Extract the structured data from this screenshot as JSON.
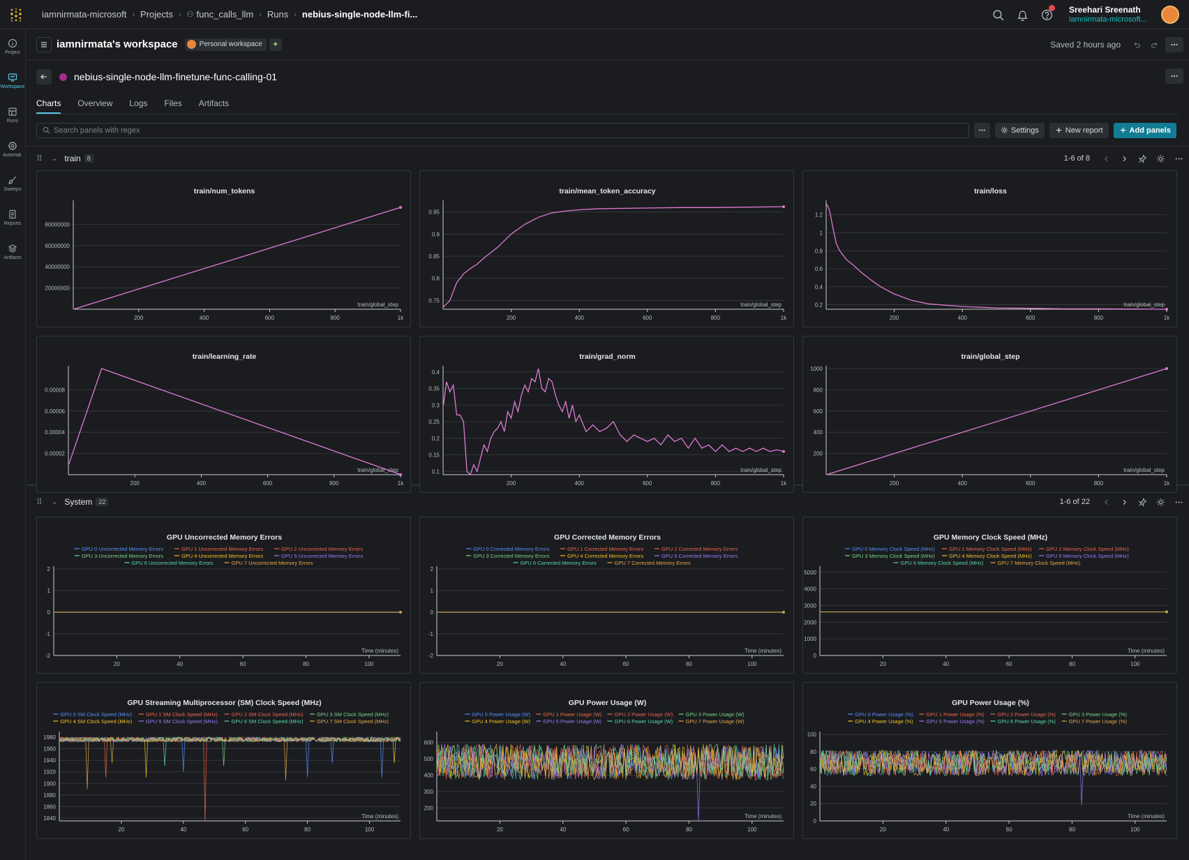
{
  "topbar": {
    "breadcrumbs": [
      "iamnirmata-microsoft",
      "Projects",
      "func_calls_llm",
      "Runs",
      "nebius-single-node-llm-fi..."
    ],
    "user_name": "Sreehari Sreenath",
    "user_handle": "iamnirmata-microsoft..."
  },
  "leftnav": {
    "items": [
      {
        "label": "Project",
        "icon": "info-icon"
      },
      {
        "label": "Workspace",
        "icon": "workspace-icon"
      },
      {
        "label": "Runs",
        "icon": "table-icon"
      },
      {
        "label": "Automat.",
        "icon": "automation-icon"
      },
      {
        "label": "Sweeps",
        "icon": "broom-icon"
      },
      {
        "label": "Reports",
        "icon": "report-icon"
      },
      {
        "label": "Artifacts",
        "icon": "layers-icon"
      }
    ]
  },
  "workspace": {
    "title": "iamnirmata's workspace",
    "badge": "Personal workspace",
    "saved": "Saved 2 hours ago"
  },
  "run": {
    "name": "nebius-single-node-llm-finetune-func-calling-01",
    "color": "#a62d8c"
  },
  "tabs": [
    "Charts",
    "Overview",
    "Logs",
    "Files",
    "Artifacts"
  ],
  "toolbar": {
    "search_placeholder": "Search panels with regex",
    "settings": "Settings",
    "new_report": "New report",
    "add_panels": "Add panels"
  },
  "sections": {
    "train": {
      "title": "train",
      "count": "8",
      "pagination": "1-6 of 8"
    },
    "system": {
      "title": "System",
      "count": "22",
      "pagination": "1-6 of 22"
    }
  },
  "gpu_colors": [
    "#5b8ff9",
    "#f4664a",
    "#e86452",
    "#7ed38a",
    "#f6c022",
    "#9d7af5",
    "#5ad8a6",
    "#e8a84a"
  ],
  "chart_data": [
    {
      "type": "line",
      "title": "train/num_tokens",
      "xlabel": "train/global_step",
      "x": [
        1,
        1000
      ],
      "y": [
        0,
        96000000
      ],
      "xlim": [
        0,
        1000
      ],
      "ylim": [
        0,
        100000000
      ],
      "xticks": [
        200,
        400,
        600,
        800,
        1000
      ],
      "xtick_labels": [
        "200",
        "400",
        "600",
        "800",
        "1k"
      ],
      "yticks": [
        20000000,
        40000000,
        60000000,
        80000000
      ],
      "ytick_labels": [
        "20000000",
        "40000000",
        "60000000",
        "80000000"
      ]
    },
    {
      "type": "line",
      "title": "train/mean_token_accuracy",
      "xlabel": "train/global_step",
      "x": [
        1,
        20,
        30,
        40,
        60,
        80,
        100,
        120,
        140,
        160,
        180,
        200,
        240,
        280,
        320,
        360,
        400,
        450,
        500,
        600,
        700,
        800,
        900,
        1000
      ],
      "y": [
        0.735,
        0.75,
        0.77,
        0.79,
        0.81,
        0.822,
        0.832,
        0.846,
        0.858,
        0.87,
        0.885,
        0.9,
        0.922,
        0.938,
        0.948,
        0.952,
        0.955,
        0.957,
        0.958,
        0.959,
        0.96,
        0.96,
        0.961,
        0.962
      ],
      "xlim": [
        0,
        1000
      ],
      "ylim": [
        0.73,
        0.97
      ],
      "xticks": [
        200,
        400,
        600,
        800,
        1000
      ],
      "xtick_labels": [
        "200",
        "400",
        "600",
        "800",
        "1k"
      ],
      "yticks": [
        0.75,
        0.8,
        0.85,
        0.9,
        0.95
      ],
      "ytick_labels": [
        "0.75",
        "0.8",
        "0.85",
        "0.9",
        "0.95"
      ]
    },
    {
      "type": "line",
      "title": "train/loss",
      "xlabel": "train/global_step",
      "x": [
        1,
        10,
        20,
        30,
        40,
        60,
        80,
        100,
        130,
        160,
        200,
        250,
        300,
        400,
        500,
        600,
        700,
        800,
        900,
        1000
      ],
      "y": [
        1.32,
        1.25,
        1.05,
        0.88,
        0.8,
        0.7,
        0.64,
        0.57,
        0.48,
        0.4,
        0.32,
        0.25,
        0.21,
        0.18,
        0.165,
        0.16,
        0.155,
        0.155,
        0.152,
        0.15
      ],
      "xlim": [
        0,
        1000
      ],
      "ylim": [
        0.15,
        1.33
      ],
      "xticks": [
        200,
        400,
        600,
        800,
        1000
      ],
      "xtick_labels": [
        "200",
        "400",
        "600",
        "800",
        "1k"
      ],
      "yticks": [
        0.2,
        0.4,
        0.6,
        0.8,
        1,
        1.2
      ],
      "ytick_labels": [
        "0.2",
        "0.4",
        "0.6",
        "0.8",
        "1",
        "1.2"
      ]
    },
    {
      "type": "line",
      "title": "train/learning_rate",
      "xlabel": "train/global_step",
      "x": [
        1,
        100,
        1000
      ],
      "y": [
        9.5e-06,
        0.0001,
        1e-07
      ],
      "xlim": [
        0,
        1000
      ],
      "ylim": [
        0,
        0.0001
      ],
      "xticks": [
        200,
        400,
        600,
        800,
        1000
      ],
      "xtick_labels": [
        "200",
        "400",
        "600",
        "800",
        "1k"
      ],
      "yticks": [
        2e-05,
        4e-05,
        6e-05,
        8e-05
      ],
      "ytick_labels": [
        "0.00002",
        "0.00004",
        "0.00006",
        "0.00008"
      ]
    },
    {
      "type": "line",
      "title": "train/grad_norm",
      "xlabel": "train/global_step",
      "x": [
        1,
        10,
        20,
        30,
        40,
        50,
        60,
        70,
        80,
        90,
        100,
        110,
        120,
        130,
        140,
        150,
        160,
        170,
        180,
        190,
        200,
        210,
        220,
        230,
        240,
        250,
        260,
        270,
        280,
        290,
        300,
        310,
        320,
        330,
        340,
        350,
        360,
        370,
        380,
        390,
        400,
        420,
        440,
        460,
        480,
        500,
        520,
        540,
        560,
        580,
        600,
        620,
        640,
        660,
        680,
        700,
        720,
        740,
        760,
        780,
        800,
        820,
        840,
        860,
        880,
        900,
        920,
        940,
        960,
        980,
        1000
      ],
      "y": [
        0.3,
        0.37,
        0.34,
        0.36,
        0.27,
        0.27,
        0.25,
        0.1,
        0.09,
        0.12,
        0.1,
        0.14,
        0.18,
        0.16,
        0.2,
        0.22,
        0.23,
        0.25,
        0.22,
        0.28,
        0.26,
        0.31,
        0.28,
        0.33,
        0.36,
        0.34,
        0.38,
        0.37,
        0.41,
        0.35,
        0.34,
        0.38,
        0.37,
        0.33,
        0.3,
        0.28,
        0.31,
        0.26,
        0.3,
        0.25,
        0.27,
        0.22,
        0.24,
        0.22,
        0.23,
        0.25,
        0.21,
        0.19,
        0.21,
        0.2,
        0.19,
        0.2,
        0.18,
        0.21,
        0.19,
        0.2,
        0.17,
        0.2,
        0.17,
        0.18,
        0.16,
        0.18,
        0.16,
        0.17,
        0.16,
        0.17,
        0.16,
        0.17,
        0.16,
        0.165,
        0.16
      ],
      "xlim": [
        0,
        1000
      ],
      "ylim": [
        0.09,
        0.41
      ],
      "xticks": [
        200,
        400,
        600,
        800,
        1000
      ],
      "xtick_labels": [
        "200",
        "400",
        "600",
        "800",
        "1k"
      ],
      "yticks": [
        0.1,
        0.15,
        0.2,
        0.25,
        0.3,
        0.35,
        0.4
      ],
      "ytick_labels": [
        "0.1",
        "0.15",
        "0.2",
        "0.25",
        "0.3",
        "0.35",
        "0.4"
      ]
    },
    {
      "type": "line",
      "title": "train/global_step",
      "xlabel": "train/global_step",
      "x": [
        1,
        1000
      ],
      "y": [
        0,
        1000
      ],
      "xlim": [
        0,
        1000
      ],
      "ylim": [
        0,
        1000
      ],
      "xticks": [
        200,
        400,
        600,
        800,
        1000
      ],
      "xtick_labels": [
        "200",
        "400",
        "600",
        "800",
        "1k"
      ],
      "yticks": [
        200,
        400,
        600,
        800,
        1000
      ],
      "ytick_labels": [
        "200",
        "400",
        "600",
        "800",
        "1000"
      ]
    },
    {
      "type": "line",
      "title": "GPU Uncorrected Memory Errors",
      "xlabel": "Time (minutes)",
      "legend": [
        "GPU 0 Uncorrected Memory Errors",
        "GPU 1 Uncorrected Memory Errors",
        "GPU 2 Uncorrected Memory Errors",
        "GPU 3 Uncorrected Memory Errors",
        "GPU 4 Uncorrected Memory Errors",
        "GPU 5 Uncorrected Memory Errors",
        "GPU 6 Uncorrected Memory Errors",
        "GPU 7 Uncorrected Memory Errors"
      ],
      "legend_rows": [
        3,
        3,
        2
      ],
      "constant": 0,
      "xlim": [
        0,
        110
      ],
      "ylim": [
        -2,
        2
      ],
      "xticks": [
        20,
        40,
        60,
        80,
        100
      ],
      "xtick_labels": [
        "20",
        "40",
        "60",
        "80",
        "100"
      ],
      "yticks": [
        -2,
        -1,
        0,
        1,
        2
      ],
      "ytick_labels": [
        "-2",
        "-1",
        "0",
        "1",
        "2"
      ]
    },
    {
      "type": "line",
      "title": "GPU Corrected Memory Errors",
      "xlabel": "Time (minutes)",
      "legend": [
        "GPU 0 Corrected Memory Errors",
        "GPU 1 Corrected Memory Errors",
        "GPU 2 Corrected Memory Errors",
        "GPU 3 Corrected Memory Errors",
        "GPU 4 Corrected Memory Errors",
        "GPU 5 Corrected Memory Errors",
        "GPU 6 Corrected Memory Errors",
        "GPU 7 Corrected Memory Errors"
      ],
      "legend_rows": [
        3,
        3,
        2
      ],
      "constant": 0,
      "xlim": [
        0,
        110
      ],
      "ylim": [
        -2,
        2
      ],
      "xticks": [
        20,
        40,
        60,
        80,
        100
      ],
      "xtick_labels": [
        "20",
        "40",
        "60",
        "80",
        "100"
      ],
      "yticks": [
        -2,
        -1,
        0,
        1,
        2
      ],
      "ytick_labels": [
        "-2",
        "-1",
        "0",
        "1",
        "2"
      ]
    },
    {
      "type": "line",
      "title": "GPU Memory Clock Speed (MHz)",
      "xlabel": "Time (minutes)",
      "legend": [
        "GPU 0 Memory Clock Speed (MHz)",
        "GPU 1 Memory Clock Speed (MHz)",
        "GPU 2 Memory Clock Speed (MHz)",
        "GPU 3 Memory Clock Speed (MHz)",
        "GPU 4 Memory Clock Speed (MHz)",
        "GPU 5 Memory Clock Speed (MHz)",
        "GPU 6 Memory Clock Speed (MHz)",
        "GPU 7 Memory Clock Speed (MHz)"
      ],
      "legend_rows": [
        3,
        3,
        2
      ],
      "constant": 2619,
      "xlim": [
        0,
        110
      ],
      "ylim": [
        0,
        5200
      ],
      "xticks": [
        20,
        40,
        60,
        80,
        100
      ],
      "xtick_labels": [
        "20",
        "40",
        "60",
        "80",
        "100"
      ],
      "yticks": [
        0,
        1000,
        2000,
        3000,
        4000,
        5000
      ],
      "ytick_labels": [
        "0",
        "1000",
        "2000",
        "3000",
        "4000",
        "5000"
      ]
    },
    {
      "type": "line",
      "title": "GPU Streaming Multiprocessor (SM) Clock Speed (MHz)",
      "xlabel": "Time (minutes)",
      "legend": [
        "GPU 0 SM Clock Speed (MHz)",
        "GPU 1 SM Clock Speed (MHz)",
        "GPU 2 SM Clock Speed (MHz)",
        "GPU 3 SM Clock Speed (MHz)",
        "GPU 4 SM Clock Speed (MHz)",
        "GPU 5 SM Clock Speed (MHz)",
        "GPU 6 SM Clock Speed (MHz)",
        "GPU 7 SM Clock Speed (MHz)"
      ],
      "legend_rows": [
        4,
        4
      ],
      "noise": {
        "base": 1980,
        "amp": 8,
        "dips": [
          [
            9,
            1890
          ],
          [
            15,
            1910
          ],
          [
            17,
            1935
          ],
          [
            28,
            1910
          ],
          [
            34,
            1930
          ],
          [
            40,
            1920
          ],
          [
            47,
            1835
          ],
          [
            53,
            1930
          ],
          [
            73,
            1905
          ],
          [
            80,
            1910
          ],
          [
            88,
            1935
          ],
          [
            104,
            1910
          ],
          [
            108,
            1935
          ]
        ]
      },
      "xlim": [
        0,
        110
      ],
      "ylim": [
        1835,
        1985
      ],
      "xticks": [
        20,
        40,
        60,
        80,
        100
      ],
      "xtick_labels": [
        "20",
        "40",
        "60",
        "80",
        "100"
      ],
      "yticks": [
        1840,
        1860,
        1880,
        1900,
        1920,
        1940,
        1960,
        1980
      ],
      "ytick_labels": [
        "1840",
        "1860",
        "1880",
        "1900",
        "1920",
        "1940",
        "1960",
        "1980"
      ]
    },
    {
      "type": "line",
      "title": "GPU Power Usage (W)",
      "xlabel": "Time (minutes)",
      "legend": [
        "GPU 0 Power Usage (W)",
        "GPU 1 Power Usage (W)",
        "GPU 2 Power Usage (W)",
        "GPU 3 Power Usage (W)",
        "GPU 4 Power Usage (W)",
        "GPU 5 Power Usage (W)",
        "GPU 6 Power Usage (W)",
        "GPU 7 Power Usage (W)"
      ],
      "legend_rows": [
        4,
        4
      ],
      "noise": {
        "base": 480,
        "amp": 110,
        "dips": [
          [
            83,
            120
          ]
        ]
      },
      "xlim": [
        0,
        110
      ],
      "ylim": [
        120,
        650
      ],
      "xticks": [
        20,
        40,
        60,
        80,
        100
      ],
      "xtick_labels": [
        "20",
        "40",
        "60",
        "80",
        "100"
      ],
      "yticks": [
        200,
        300,
        400,
        500,
        600
      ],
      "ytick_labels": [
        "200",
        "300",
        "400",
        "500",
        "600"
      ]
    },
    {
      "type": "line",
      "title": "GPU Power Usage (%)",
      "xlabel": "Time (minutes)",
      "legend": [
        "GPU 0 Power Usage (%)",
        "GPU 1 Power Usage (%)",
        "GPU 2 Power Usage (%)",
        "GPU 3 Power Usage (%)",
        "GPU 4 Power Usage (%)",
        "GPU 5 Power Usage (%)",
        "GPU 6 Power Usage (%)",
        "GPU 7 Power Usage (%)"
      ],
      "legend_rows": [
        4,
        4
      ],
      "noise": {
        "base": 67,
        "amp": 15,
        "dips": [
          [
            83,
            18
          ]
        ]
      },
      "xlim": [
        0,
        110
      ],
      "ylim": [
        0,
        100
      ],
      "xticks": [
        20,
        40,
        60,
        80,
        100
      ],
      "xtick_labels": [
        "20",
        "40",
        "60",
        "80",
        "100"
      ],
      "yticks": [
        0,
        20,
        40,
        60,
        80,
        100
      ],
      "ytick_labels": [
        "0",
        "20",
        "40",
        "60",
        "80",
        "100"
      ]
    }
  ]
}
